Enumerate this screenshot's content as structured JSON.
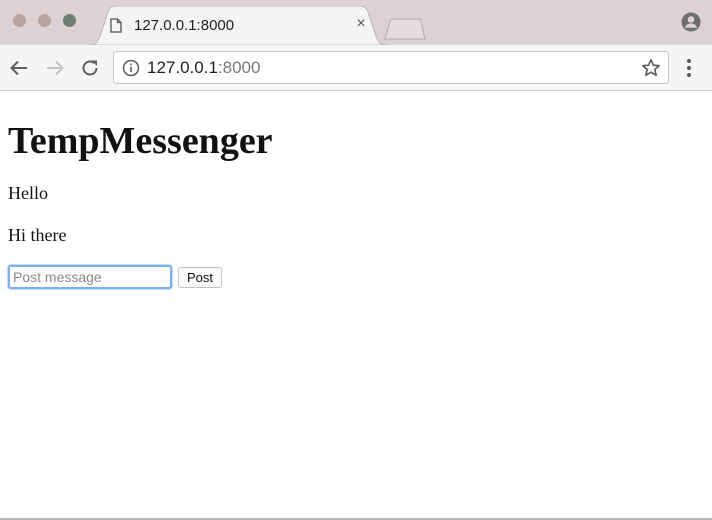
{
  "browser": {
    "tab": {
      "title": "127.0.0.1:8000",
      "close_glyph": "×",
      "icon": "page-icon"
    },
    "address_bar": {
      "host": "127.0.0.1",
      "port": ":8000",
      "info_icon": "info-icon",
      "bookmark_icon": "star-icon"
    },
    "nav": {
      "back_icon": "back-arrow-icon",
      "forward_icon": "forward-arrow-icon",
      "reload_icon": "reload-icon",
      "menu_icon": "kebab-menu-icon",
      "profile_icon": "profile-icon"
    },
    "colors": {
      "tabstrip": "#ddd1d3",
      "toolbar": "#f5f5f5",
      "focus_ring": "#7fb0ee"
    }
  },
  "page": {
    "heading": "TempMessenger",
    "messages": [
      "Hello",
      "Hi there"
    ],
    "form": {
      "input_value": "",
      "input_placeholder": "Post message",
      "button_label": "Post"
    }
  }
}
